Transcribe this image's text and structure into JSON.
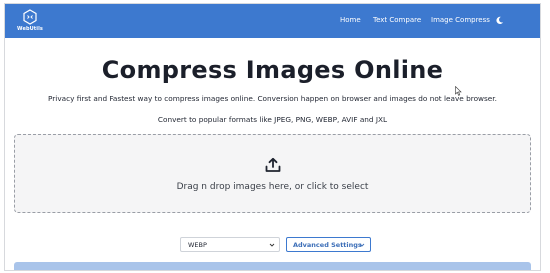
{
  "brand": {
    "name": "WebUtils"
  },
  "nav": {
    "items": [
      {
        "label": "Home"
      },
      {
        "label": "Text Compare"
      },
      {
        "label": "Image Compress"
      }
    ],
    "theme_icon": "moon-icon"
  },
  "main": {
    "title": "Compress Images Online",
    "subtitle": "Privacy first and Fastest way to compress images online. Conversion happen on browser and images do not leave browser.",
    "formats_text": "Convert to popular formats like JPEG, PNG, WEBP, AVIF and JXL",
    "dropzone": {
      "icon": "upload-icon",
      "text": "Drag n drop images here, or click to select"
    },
    "format_select": {
      "value": "WEBP"
    },
    "advanced_button": {
      "label": "Advanced Settings"
    }
  },
  "colors": {
    "navbar": "#3d79cf",
    "primary_button_disabled": "#a9c4ea",
    "dropzone_bg": "#f5f5f6"
  }
}
